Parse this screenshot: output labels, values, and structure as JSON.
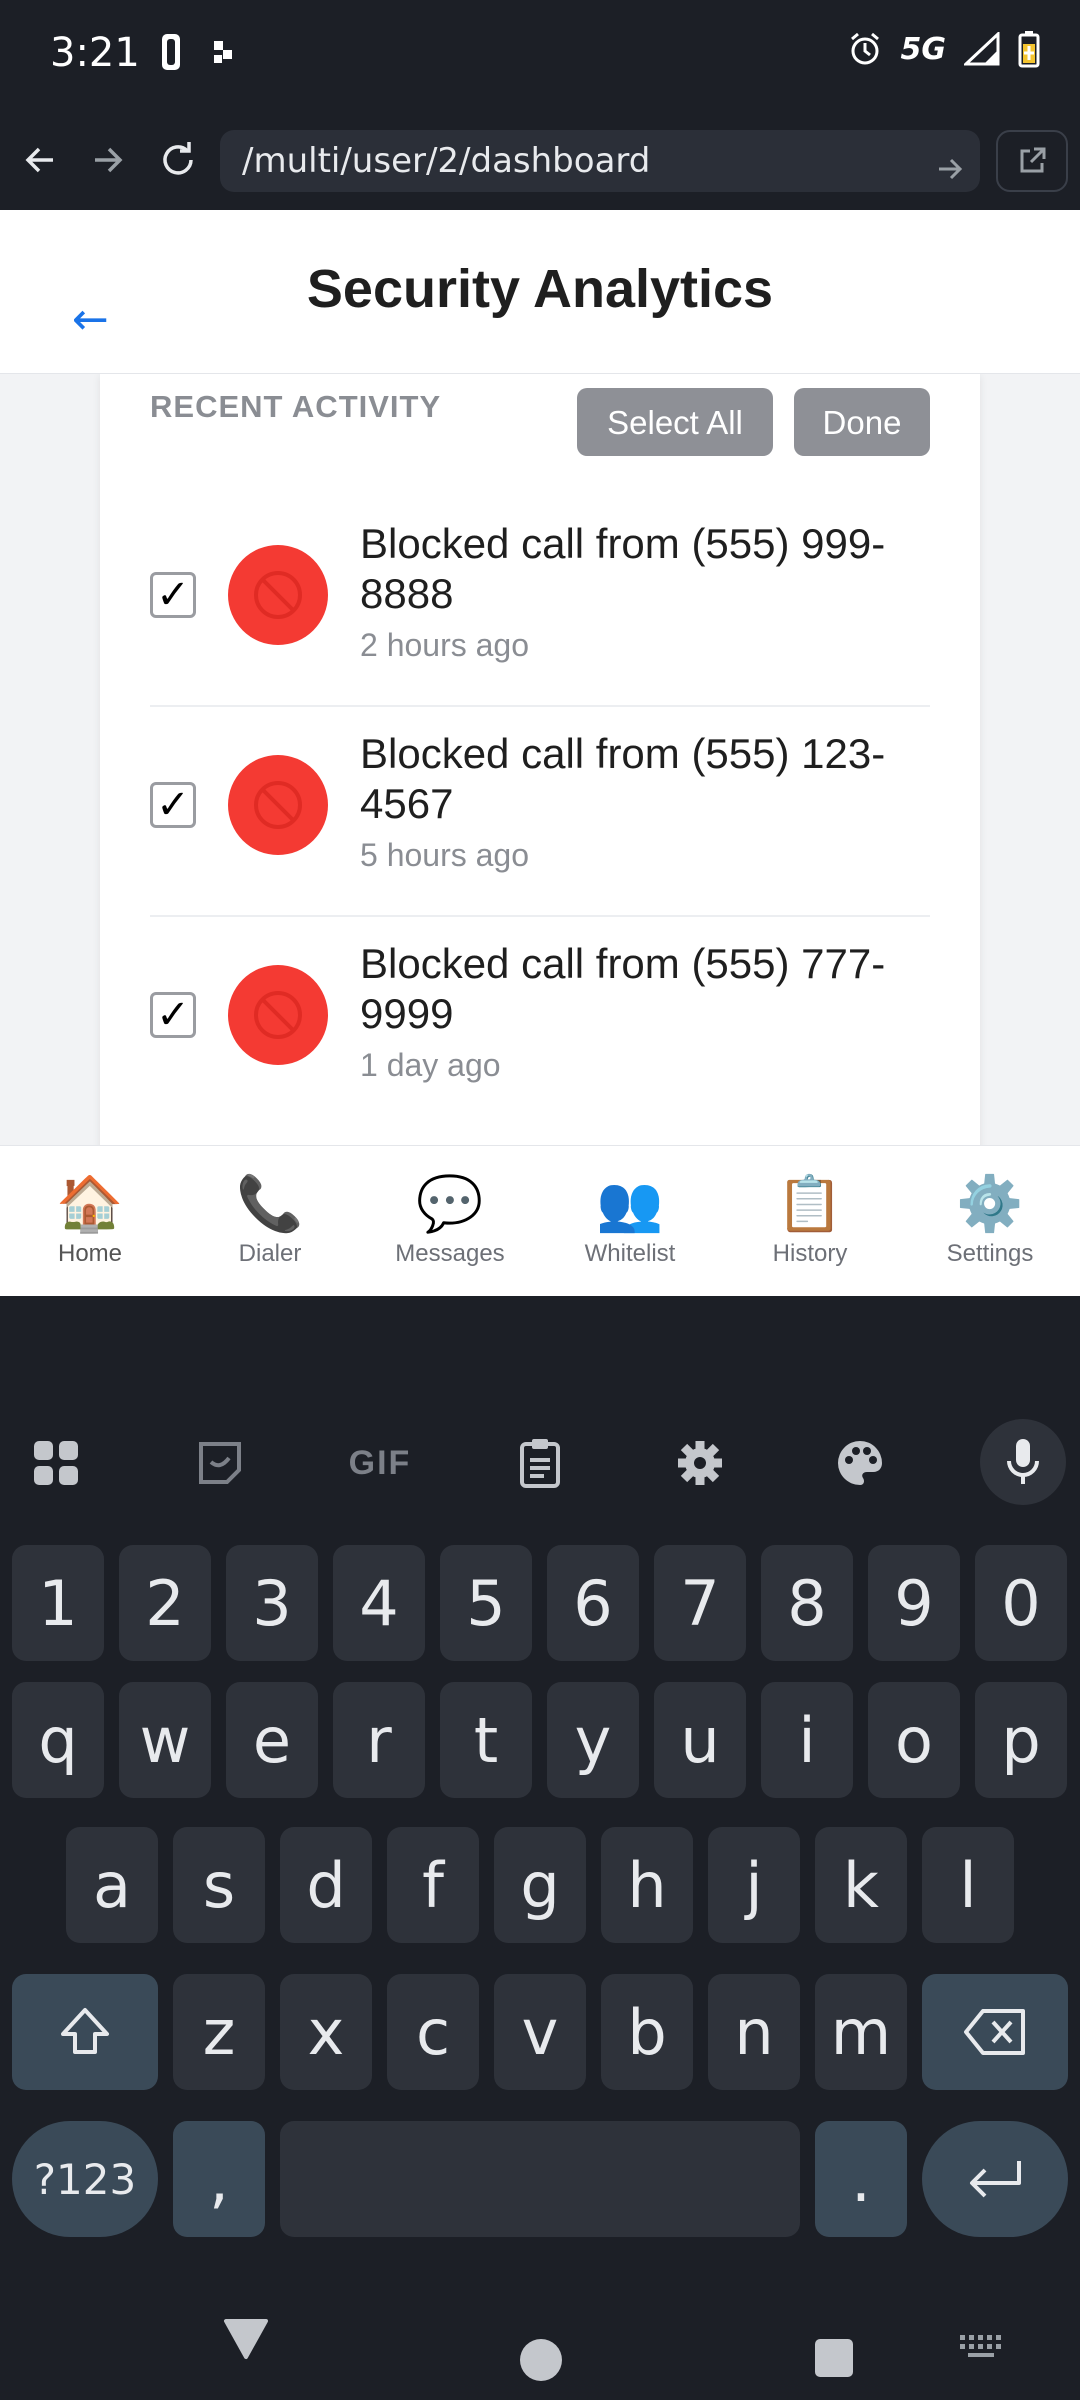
{
  "status_bar": {
    "time": "3:21",
    "network": "5G"
  },
  "browser": {
    "url": "/multi/user/2/dashboard"
  },
  "header": {
    "back_arrow": "←",
    "title": "Security Analytics"
  },
  "activity": {
    "section_label": "RECENT ACTIVITY",
    "select_all_label": "Select All",
    "done_label": "Done",
    "checkmark": "✓",
    "items": [
      {
        "title": "Blocked call from (555) 999-8888",
        "time": "2 hours ago"
      },
      {
        "title": "Blocked call from (555) 123-4567",
        "time": "5 hours ago"
      },
      {
        "title": "Blocked call from (555) 777-9999",
        "time": "1 day ago"
      }
    ]
  },
  "bottom_nav": {
    "items": [
      {
        "label": "Home",
        "icon": "🏠"
      },
      {
        "label": "Dialer",
        "icon": "📞"
      },
      {
        "label": "Messages",
        "icon": "💬"
      },
      {
        "label": "Whitelist",
        "icon": "👥"
      },
      {
        "label": "History",
        "icon": "📋"
      },
      {
        "label": "Settings",
        "icon": "⚙️"
      }
    ]
  },
  "keyboard": {
    "row_numbers": [
      "1",
      "2",
      "3",
      "4",
      "5",
      "6",
      "7",
      "8",
      "9",
      "0"
    ],
    "row1": [
      "q",
      "w",
      "e",
      "r",
      "t",
      "y",
      "u",
      "i",
      "o",
      "p"
    ],
    "row2": [
      "a",
      "s",
      "d",
      "f",
      "g",
      "h",
      "j",
      "k",
      "l"
    ],
    "row3": [
      "z",
      "x",
      "c",
      "v",
      "b",
      "n",
      "m"
    ],
    "symbols_label": "?123",
    "comma": ",",
    "period": ".",
    "gif_label": "GIF"
  },
  "colors": {
    "accent": "#1a73e8",
    "block_red": "#f43a33",
    "button_gray": "#8e9096"
  }
}
